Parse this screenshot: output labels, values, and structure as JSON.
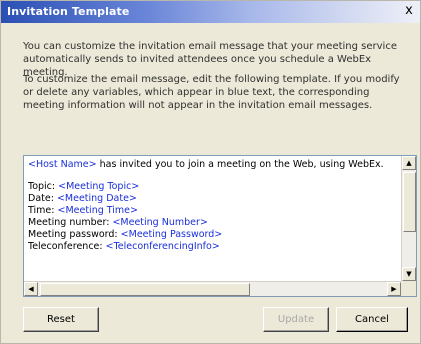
{
  "window": {
    "title": "Invitation Template",
    "close_glyph": "x"
  },
  "description": {
    "paragraph1": "You can customize the invitation email message that your meeting service automatically sends to invited attendees once you schedule a WebEx meeting.",
    "paragraph2": "To customize the email message, edit the following template. If you modify or delete any variables, which appear in blue text, the corresponding meeting information will not appear in the invitation email messages."
  },
  "template": {
    "line1": {
      "var": "<Host Name>",
      "text": " has invited you to join a meeting on the Web, using WebEx."
    },
    "topic": {
      "label": "Topic: ",
      "var": "<Meeting Topic>"
    },
    "date": {
      "label": "Date: ",
      "var": "<Meeting Date>"
    },
    "time": {
      "label": "Time: ",
      "var": "<Meeting Time>"
    },
    "number": {
      "label": "Meeting number: ",
      "var": "<Meeting Number>"
    },
    "password": {
      "label": "Meeting password: ",
      "var": "<Meeting Password>"
    },
    "teleconference": {
      "label": "Teleconference: ",
      "var": "<TeleconferencingInfo>"
    },
    "variable_color": "#1a2fd8"
  },
  "buttons": {
    "reset": "Reset",
    "update": "Update",
    "cancel": "Cancel"
  }
}
